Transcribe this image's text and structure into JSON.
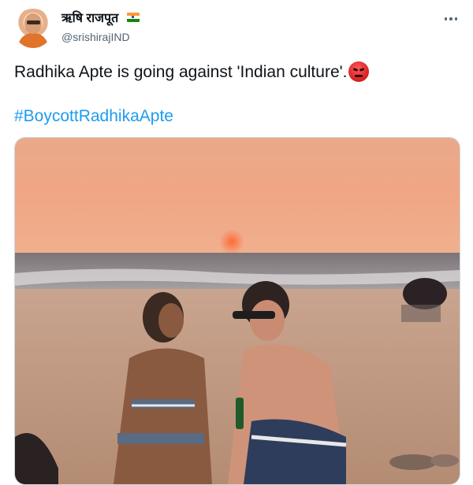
{
  "user": {
    "display_name": "ऋषि राजपूत",
    "handle": "@srishirajIND",
    "flag_icon": "india-flag-icon",
    "avatar_icon": "avatar"
  },
  "tweet": {
    "text": "Radhika Apte is going against 'Indian culture'.",
    "emoji": "angry-face-icon",
    "hashtag": "#BoycottRadhikaApte"
  },
  "menu": {
    "icon": "more-options-icon"
  },
  "colors": {
    "text": "#0f1419",
    "secondary": "#536471",
    "link": "#1d9bf0",
    "border": "#cfd9de"
  },
  "photo": {
    "subject": "beach-sunset-photo"
  }
}
